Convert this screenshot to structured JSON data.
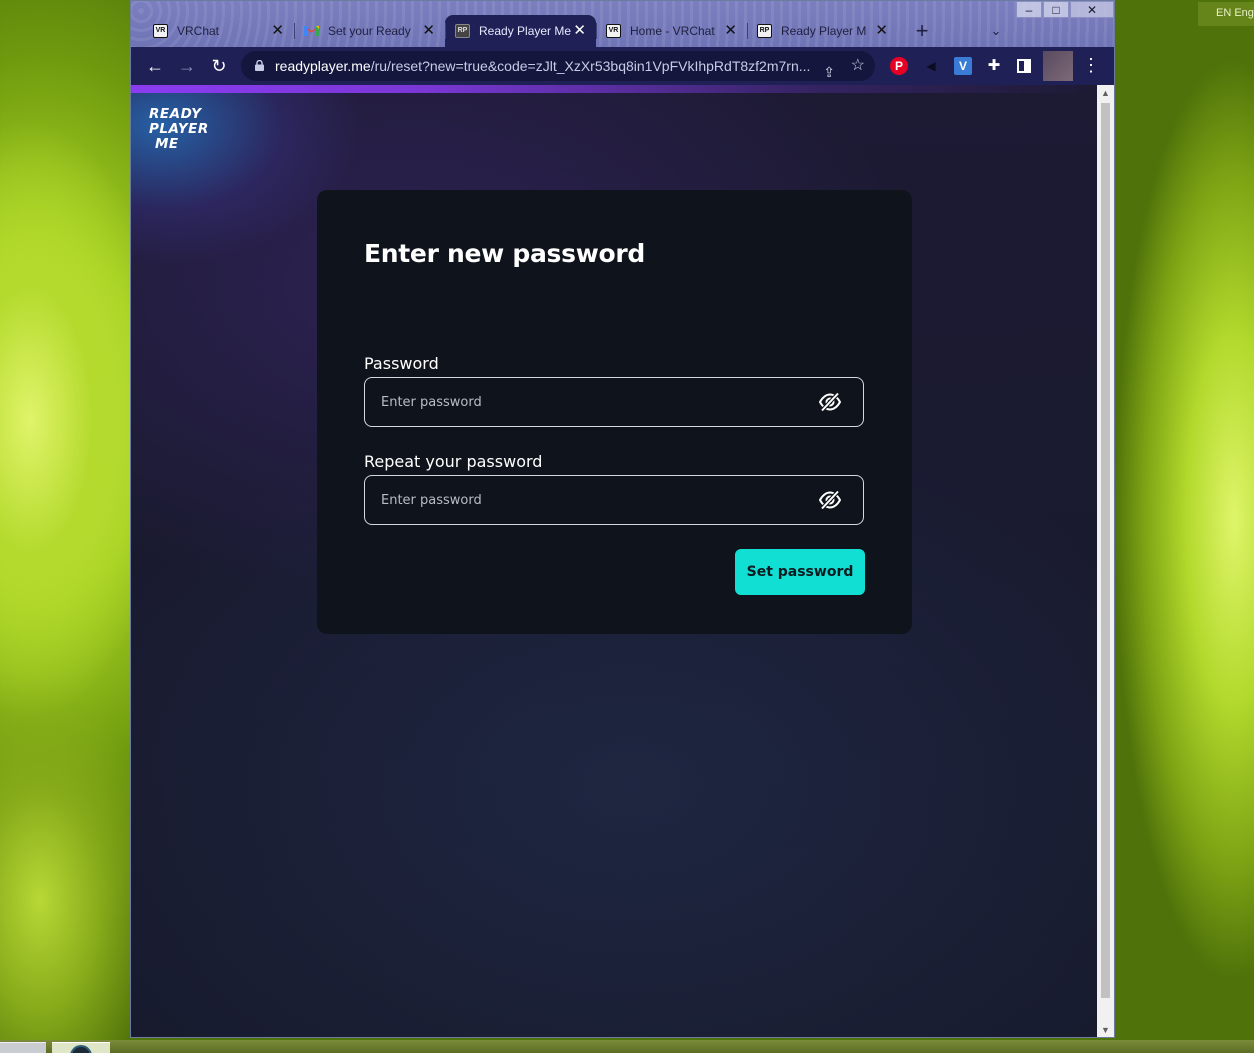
{
  "desktop": {
    "language_indicator": "EN Eng"
  },
  "browser": {
    "window_controls": {
      "minimize": "–",
      "maximize": "□",
      "close": "✕"
    },
    "tabs": [
      {
        "title": "VRChat",
        "icon": "vrchat-icon",
        "active": false
      },
      {
        "title": "Set your Ready",
        "icon": "gmail-icon",
        "active": false
      },
      {
        "title": "Ready Player Me",
        "icon": "readyplayerme-icon",
        "active": true
      },
      {
        "title": "Home - VRChat",
        "icon": "vrchat-icon",
        "active": false
      },
      {
        "title": "Ready Player M",
        "icon": "readyplayerme-icon",
        "active": false
      }
    ],
    "address_bar": {
      "host": "readyplayer.me",
      "path": "/ru/reset?new=true&code=zJlt_XzXr53bq8in1VpFVkIhpRdT8zf2m7rn..."
    },
    "extensions": [
      "pinterest-icon",
      "speaker-icon",
      "v-extension-icon",
      "puzzle-icon",
      "side-panel-icon"
    ]
  },
  "page": {
    "logo": {
      "line1": "READY",
      "line2": "PLAYER",
      "line3": "ME"
    },
    "title": "Enter new password",
    "password_field": {
      "label": "Password",
      "placeholder": "Enter password",
      "value": ""
    },
    "repeat_field": {
      "label": "Repeat your password",
      "placeholder": "Enter password",
      "value": ""
    },
    "submit_label": "Set password",
    "colors": {
      "accent": "#12dfd4",
      "card_bg": "#0f141c",
      "toolbar_bg": "#1f2156"
    }
  }
}
